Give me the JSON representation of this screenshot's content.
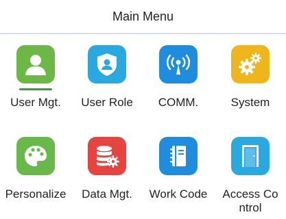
{
  "header": {
    "title": "Main Menu"
  },
  "menu": {
    "items": [
      {
        "label": "User Mgt.",
        "icon": "user-icon",
        "color": "#6cb847",
        "selected": true
      },
      {
        "label": "User Role",
        "icon": "shield-user-icon",
        "color": "#29a9df"
      },
      {
        "label": "COMM.",
        "icon": "antenna-icon",
        "color": "#1e8ddd"
      },
      {
        "label": "System",
        "icon": "gears-icon",
        "color": "#f1b51c"
      },
      {
        "label": "Personalize",
        "icon": "palette-icon",
        "color": "#69b94a"
      },
      {
        "label": "Data Mgt.",
        "icon": "database-gear-icon",
        "color": "#e8443f"
      },
      {
        "label": "Work Code",
        "icon": "notebook-icon",
        "color": "#1e8ddd"
      },
      {
        "label": "Access Co\nntrol",
        "icon": "door-icon",
        "color": "#29a9df"
      }
    ]
  }
}
